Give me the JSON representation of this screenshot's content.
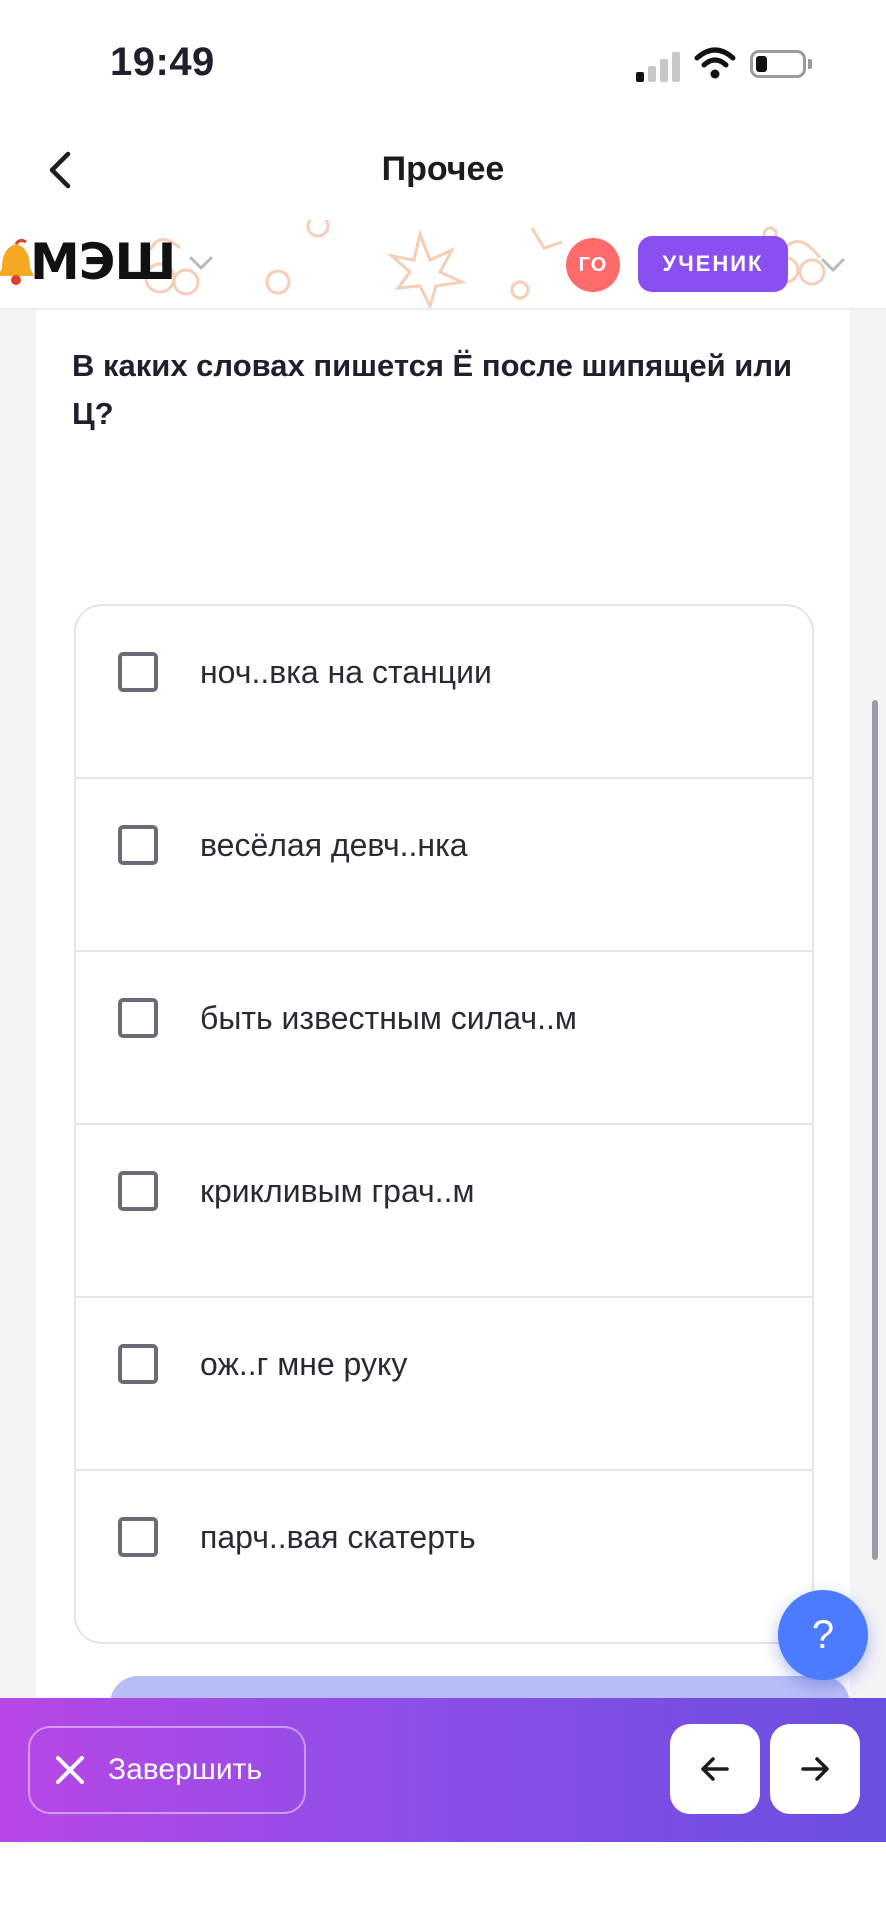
{
  "status_bar": {
    "time": "19:49"
  },
  "nav": {
    "title": "Прочее"
  },
  "app_header": {
    "logo_text": "МЭШ",
    "avatar_initials": "ГО",
    "role_label": "УЧЕНИК"
  },
  "question": {
    "text": "В каких словах пишется Ё после шипящей или Ц?",
    "options": [
      {
        "label": "ноч..вка на станции",
        "checked": false
      },
      {
        "label": "весёлая девч..нка",
        "checked": false
      },
      {
        "label": "быть известным силач..м",
        "checked": false
      },
      {
        "label": "крикливым грач..м",
        "checked": false
      },
      {
        "label": "ож..г мне руку",
        "checked": false
      },
      {
        "label": "парч..вая скатерть",
        "checked": false
      }
    ]
  },
  "help": {
    "label": "?"
  },
  "bottom_bar": {
    "finish_label": "Завершить"
  },
  "colors": {
    "accent": "#8a4ff0",
    "avatar": "#ff6b6b",
    "help": "#4b7bff",
    "bar_gradient_start": "#b847e6",
    "bar_gradient_end": "#6a4fe0"
  },
  "icons": {
    "back": "chevron-left-icon",
    "dropdown": "chevron-down-icon",
    "finish": "close-icon",
    "prev": "arrow-left-icon",
    "next": "arrow-right-icon"
  }
}
